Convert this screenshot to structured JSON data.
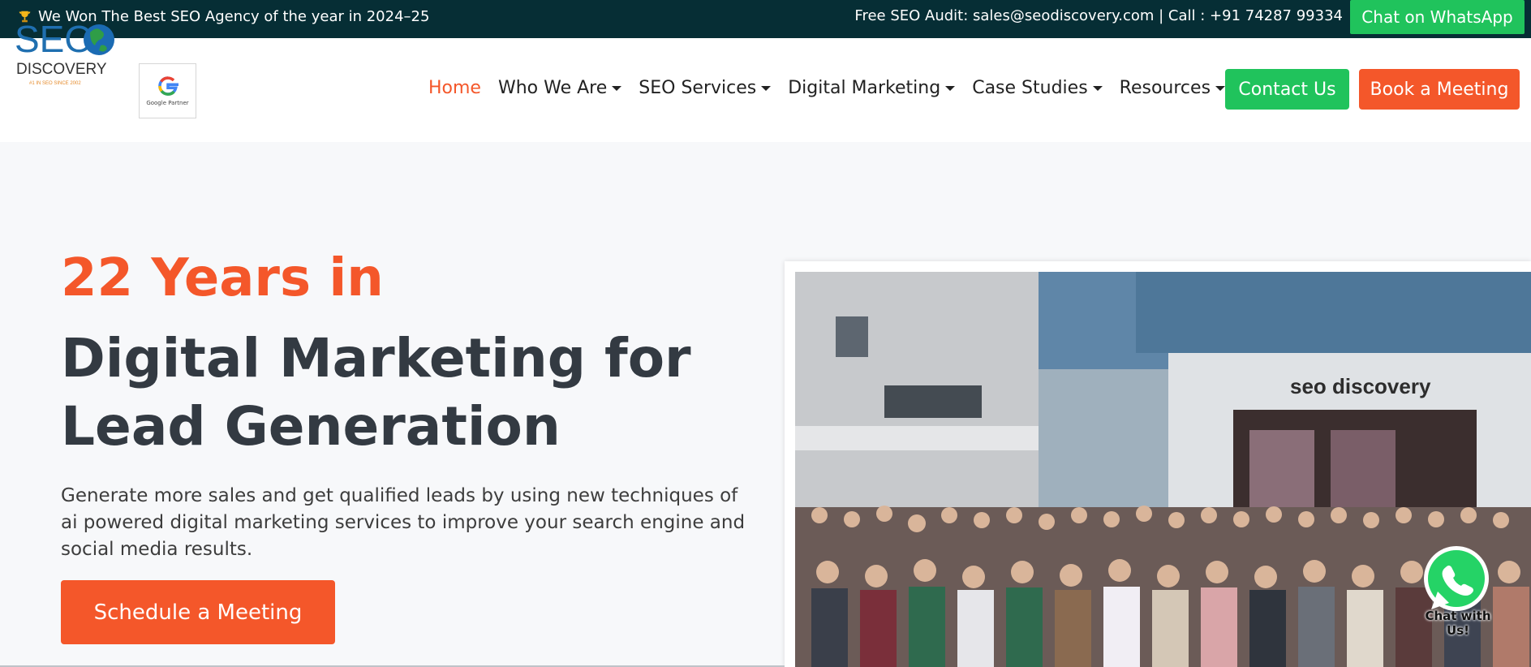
{
  "topbar": {
    "award_text": "We Won The Best SEO Agency of the year in 2024–25",
    "contact_text": "Free SEO Audit: sales@seodiscovery.com | Call : +91 74287 99334",
    "whatsapp_label": "Chat on WhatsApp"
  },
  "logo": {
    "line1": "SEO",
    "line2": "DISCOVERY",
    "tagline": "#1 IN SEO SINCE 2002",
    "google_partner": "Google Partner"
  },
  "nav": {
    "items": [
      {
        "label": "Home",
        "active": true
      },
      {
        "label": "Who We Are"
      },
      {
        "label": "SEO Services"
      },
      {
        "label": "Digital Marketing"
      },
      {
        "label": "Case Studies"
      },
      {
        "label": "Resources"
      }
    ],
    "contact_label": "Contact Us",
    "book_label": "Book a Meeting"
  },
  "hero": {
    "kicker": "22 Years in",
    "title": "Digital Marketing for Lead Generation",
    "description": "Generate more sales and get qualified leads by using new techniques of ai powered digital marketing services to improve your search engine and social media results.",
    "cta_label": "Schedule a Meeting",
    "photo_sign": "seo discovery"
  },
  "chat_widget": {
    "label": "Chat with Us!"
  },
  "colors": {
    "accent": "#f4572a",
    "green": "#20c35c",
    "topbar": "#062e35",
    "heading": "#333a42"
  }
}
